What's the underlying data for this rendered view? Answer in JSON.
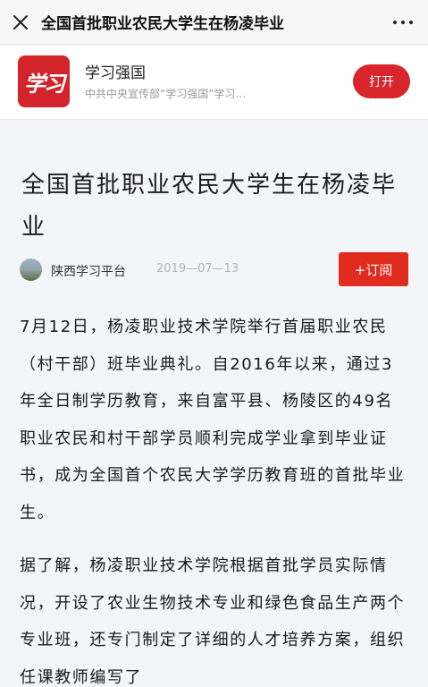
{
  "topbar": {
    "close_icon": "close-icon",
    "title": "全国首批职业农民大学生在杨凌毕业",
    "more_icon": "more-dots-icon"
  },
  "app_banner": {
    "logo_text": "学习",
    "logo_color": "#d4242b",
    "name": "学习强国",
    "description": "中共中央宣传部“学习强国”学习…",
    "open_label": "打开",
    "accent": "#d9262d"
  },
  "article": {
    "title": "全国首批职业农民大学生在杨凌毕业",
    "source": "陕西学习平台",
    "date": "2019—07—13",
    "subscribe_label": "+订阅",
    "paragraphs": [
      "7月12日，杨凌职业技术学院举行首届职业农民（村干部）班毕业典礼。自2016年以来，通过3年全日制学历教育，来自富平县、杨陵区的49名职业农民和村干部学员顺利完成学业拿到毕业证书，成为全国首个农民大学学历教育班的首批毕业生。",
      "据了解，杨凌职业技术学院根据首批学员实际情况，开设了农业生物技术专业和绿色食品生产两个专业班，还专门制定了详细的人才培养方案，组织任课教师编写了"
    ]
  }
}
